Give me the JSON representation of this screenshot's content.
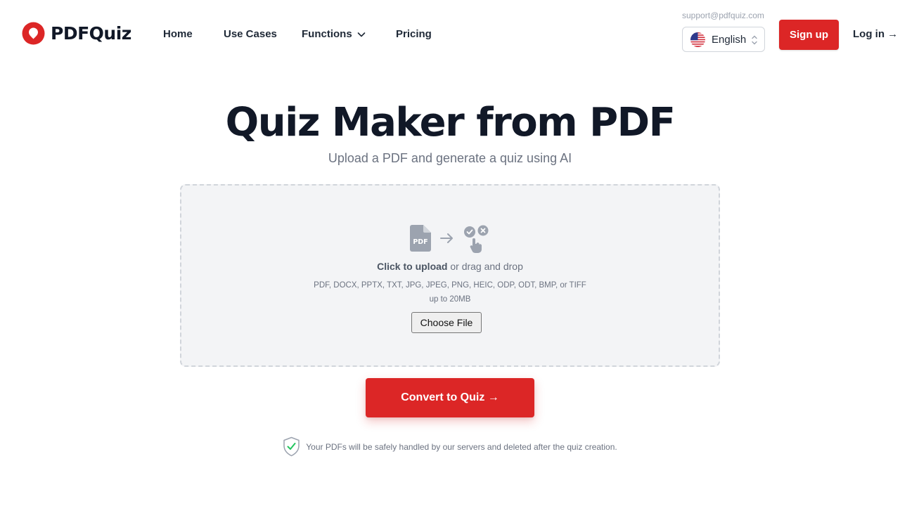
{
  "header": {
    "brand": "PDFQuiz",
    "nav": {
      "home": "Home",
      "use_cases": "Use Cases",
      "functions": "Functions",
      "pricing": "Pricing"
    },
    "support_email": "support@pdfquiz.com",
    "language": "English",
    "signup_label": "Sign up",
    "login_label": "Log in →"
  },
  "hero": {
    "title": "Quiz Maker from PDF",
    "subtitle": "Upload a PDF and generate a quiz using AI"
  },
  "upload": {
    "click_label": "Click to upload",
    "drag_label": " or drag and drop",
    "formats": "PDF, DOCX, PPTX, TXT, JPG, JPEG, PNG, HEIC, ODP, ODT, BMP, or TIFF",
    "size_limit": "up to 20MB",
    "choose_file_label": "Choose File",
    "pdf_icon_text": "PDF"
  },
  "convert_label": "Convert to Quiz →",
  "privacy_notice": "Your PDFs will be safely handled by our servers and deleted after the quiz creation.",
  "colors": {
    "accent": "#dc2626",
    "text_dark": "#111827",
    "muted": "#6b7280",
    "dropzone_bg": "#f3f4f6"
  },
  "icons": [
    "pdfquiz-logo-icon",
    "chevron-down-icon",
    "us-flag-icon",
    "chevron-up-down-icon",
    "pdf-file-icon",
    "arrow-right-icon",
    "quiz-hand-icon",
    "shield-check-icon"
  ]
}
